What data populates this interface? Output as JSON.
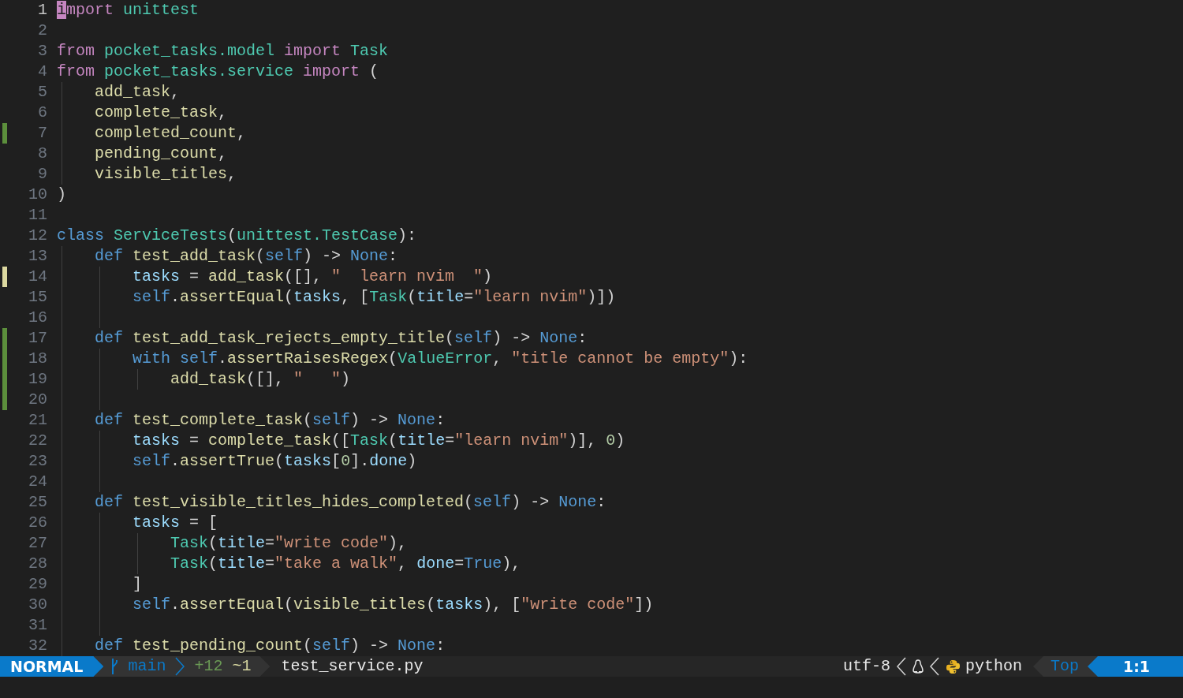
{
  "editor": {
    "lines": [
      {
        "number": "1",
        "cursor": true,
        "tokens": [
          {
            "kind": "keyword",
            "text": "import "
          },
          {
            "kind": "type",
            "text": "unittest"
          }
        ]
      },
      {
        "number": "2"
      },
      {
        "number": "3",
        "tokens": [
          {
            "kind": "keyword",
            "text": "from "
          },
          {
            "kind": "type",
            "text": "pocket_tasks.model "
          },
          {
            "kind": "keyword",
            "text": "import "
          },
          {
            "kind": "type",
            "text": "Task"
          }
        ]
      },
      {
        "number": "4",
        "tokens": [
          {
            "kind": "keyword",
            "text": "from "
          },
          {
            "kind": "type",
            "text": "pocket_tasks.service "
          },
          {
            "kind": "keyword",
            "text": "import "
          },
          {
            "kind": "plain",
            "text": "("
          }
        ]
      },
      {
        "number": "5",
        "tokens": [
          {
            "kind": "func",
            "text": "    add_task"
          },
          {
            "kind": "plain",
            "text": ","
          }
        ]
      },
      {
        "number": "6",
        "tokens": [
          {
            "kind": "func",
            "text": "    complete_task"
          },
          {
            "kind": "plain",
            "text": ","
          }
        ]
      },
      {
        "number": "7",
        "git_added": true,
        "tokens": [
          {
            "kind": "func",
            "text": "    completed_count"
          },
          {
            "kind": "plain",
            "text": ","
          }
        ]
      },
      {
        "number": "8",
        "tokens": [
          {
            "kind": "func",
            "text": "    pending_count"
          },
          {
            "kind": "plain",
            "text": ","
          }
        ]
      },
      {
        "number": "9",
        "tokens": [
          {
            "kind": "func",
            "text": "    visible_titles"
          },
          {
            "kind": "plain",
            "text": ","
          }
        ]
      },
      {
        "number": "10",
        "tokens": [
          {
            "kind": "plain",
            "text": ")"
          }
        ]
      },
      {
        "number": "11"
      },
      {
        "number": "12",
        "tokens": [
          {
            "kind": "storage",
            "text": "class "
          },
          {
            "kind": "type",
            "text": "ServiceTests"
          },
          {
            "kind": "plain",
            "text": "("
          },
          {
            "kind": "type",
            "text": "unittest.TestCase"
          },
          {
            "kind": "plain",
            "text": "):"
          }
        ]
      },
      {
        "number": "13",
        "tokens": [
          {
            "kind": "storage",
            "text": "    def "
          },
          {
            "kind": "func",
            "text": "test_add_task"
          },
          {
            "kind": "plain",
            "text": "("
          },
          {
            "kind": "storage",
            "text": "self"
          },
          {
            "kind": "plain",
            "text": ") -> "
          },
          {
            "kind": "storage",
            "text": "None"
          },
          {
            "kind": "plain",
            "text": ":"
          }
        ]
      },
      {
        "number": "14",
        "git_changed": true,
        "tokens": [
          {
            "kind": "var",
            "text": "        tasks"
          },
          {
            "kind": "plain",
            "text": " = "
          },
          {
            "kind": "func",
            "text": "add_task"
          },
          {
            "kind": "plain",
            "text": "([], "
          },
          {
            "kind": "str",
            "text": "\"  learn nvim  \""
          },
          {
            "kind": "plain",
            "text": ")"
          }
        ]
      },
      {
        "number": "15",
        "tokens": [
          {
            "kind": "storage",
            "text": "        self"
          },
          {
            "kind": "plain",
            "text": "."
          },
          {
            "kind": "func",
            "text": "assertEqual"
          },
          {
            "kind": "plain",
            "text": "("
          },
          {
            "kind": "var",
            "text": "tasks"
          },
          {
            "kind": "plain",
            "text": ", ["
          },
          {
            "kind": "type",
            "text": "Task"
          },
          {
            "kind": "plain",
            "text": "("
          },
          {
            "kind": "var",
            "text": "title"
          },
          {
            "kind": "plain",
            "text": "="
          },
          {
            "kind": "str",
            "text": "\"learn nvim\""
          },
          {
            "kind": "plain",
            "text": ")])"
          }
        ]
      },
      {
        "number": "16"
      },
      {
        "number": "17",
        "git_added": true,
        "tokens": [
          {
            "kind": "storage",
            "text": "    def "
          },
          {
            "kind": "func",
            "text": "test_add_task_rejects_empty_title"
          },
          {
            "kind": "plain",
            "text": "("
          },
          {
            "kind": "storage",
            "text": "self"
          },
          {
            "kind": "plain",
            "text": ") -> "
          },
          {
            "kind": "storage",
            "text": "None"
          },
          {
            "kind": "plain",
            "text": ":"
          }
        ]
      },
      {
        "number": "18",
        "git_added": true,
        "tokens": [
          {
            "kind": "storage",
            "text": "        with self"
          },
          {
            "kind": "plain",
            "text": "."
          },
          {
            "kind": "func",
            "text": "assertRaisesRegex"
          },
          {
            "kind": "plain",
            "text": "("
          },
          {
            "kind": "type",
            "text": "ValueError"
          },
          {
            "kind": "plain",
            "text": ", "
          },
          {
            "kind": "str",
            "text": "\"title cannot be empty\""
          },
          {
            "kind": "plain",
            "text": "):"
          }
        ]
      },
      {
        "number": "19",
        "git_added": true,
        "tokens": [
          {
            "kind": "func",
            "text": "            add_task"
          },
          {
            "kind": "plain",
            "text": "([], "
          },
          {
            "kind": "str",
            "text": "\"   \""
          },
          {
            "kind": "plain",
            "text": ")"
          }
        ]
      },
      {
        "number": "20",
        "git_added": true
      },
      {
        "number": "21",
        "tokens": [
          {
            "kind": "storage",
            "text": "    def "
          },
          {
            "kind": "func",
            "text": "test_complete_task"
          },
          {
            "kind": "plain",
            "text": "("
          },
          {
            "kind": "storage",
            "text": "self"
          },
          {
            "kind": "plain",
            "text": ") -> "
          },
          {
            "kind": "storage",
            "text": "None"
          },
          {
            "kind": "plain",
            "text": ":"
          }
        ]
      },
      {
        "number": "22",
        "tokens": [
          {
            "kind": "var",
            "text": "        tasks"
          },
          {
            "kind": "plain",
            "text": " = "
          },
          {
            "kind": "func",
            "text": "complete_task"
          },
          {
            "kind": "plain",
            "text": "(["
          },
          {
            "kind": "type",
            "text": "Task"
          },
          {
            "kind": "plain",
            "text": "("
          },
          {
            "kind": "var",
            "text": "title"
          },
          {
            "kind": "plain",
            "text": "="
          },
          {
            "kind": "str",
            "text": "\"learn nvim\""
          },
          {
            "kind": "plain",
            "text": ")], "
          },
          {
            "kind": "num",
            "text": "0"
          },
          {
            "kind": "plain",
            "text": ")"
          }
        ]
      },
      {
        "number": "23",
        "tokens": [
          {
            "kind": "storage",
            "text": "        self"
          },
          {
            "kind": "plain",
            "text": "."
          },
          {
            "kind": "func",
            "text": "assertTrue"
          },
          {
            "kind": "plain",
            "text": "("
          },
          {
            "kind": "var",
            "text": "tasks"
          },
          {
            "kind": "plain",
            "text": "["
          },
          {
            "kind": "num",
            "text": "0"
          },
          {
            "kind": "plain",
            "text": "]."
          },
          {
            "kind": "var",
            "text": "done"
          },
          {
            "kind": "plain",
            "text": ")"
          }
        ]
      },
      {
        "number": "24"
      },
      {
        "number": "25",
        "tokens": [
          {
            "kind": "storage",
            "text": "    def "
          },
          {
            "kind": "func",
            "text": "test_visible_titles_hides_completed"
          },
          {
            "kind": "plain",
            "text": "("
          },
          {
            "kind": "storage",
            "text": "self"
          },
          {
            "kind": "plain",
            "text": ") -> "
          },
          {
            "kind": "storage",
            "text": "None"
          },
          {
            "kind": "plain",
            "text": ":"
          }
        ]
      },
      {
        "number": "26",
        "tokens": [
          {
            "kind": "var",
            "text": "        tasks"
          },
          {
            "kind": "plain",
            "text": " = ["
          }
        ]
      },
      {
        "number": "27",
        "tokens": [
          {
            "kind": "type",
            "text": "            Task"
          },
          {
            "kind": "plain",
            "text": "("
          },
          {
            "kind": "var",
            "text": "title"
          },
          {
            "kind": "plain",
            "text": "="
          },
          {
            "kind": "str",
            "text": "\"write code\""
          },
          {
            "kind": "plain",
            "text": "),"
          }
        ]
      },
      {
        "number": "28",
        "tokens": [
          {
            "kind": "type",
            "text": "            Task"
          },
          {
            "kind": "plain",
            "text": "("
          },
          {
            "kind": "var",
            "text": "title"
          },
          {
            "kind": "plain",
            "text": "="
          },
          {
            "kind": "str",
            "text": "\"take a walk\""
          },
          {
            "kind": "plain",
            "text": ", "
          },
          {
            "kind": "var",
            "text": "done"
          },
          {
            "kind": "plain",
            "text": "="
          },
          {
            "kind": "storage",
            "text": "True"
          },
          {
            "kind": "plain",
            "text": "),"
          }
        ]
      },
      {
        "number": "29",
        "tokens": [
          {
            "kind": "plain",
            "text": "        ]"
          }
        ]
      },
      {
        "number": "30",
        "tokens": [
          {
            "kind": "storage",
            "text": "        self"
          },
          {
            "kind": "plain",
            "text": "."
          },
          {
            "kind": "func",
            "text": "assertEqual"
          },
          {
            "kind": "plain",
            "text": "("
          },
          {
            "kind": "func",
            "text": "visible_titles"
          },
          {
            "kind": "plain",
            "text": "("
          },
          {
            "kind": "var",
            "text": "tasks"
          },
          {
            "kind": "plain",
            "text": "), ["
          },
          {
            "kind": "str",
            "text": "\"write code\""
          },
          {
            "kind": "plain",
            "text": "])"
          }
        ]
      },
      {
        "number": "31"
      },
      {
        "number": "32",
        "tokens": [
          {
            "kind": "storage",
            "text": "    def "
          },
          {
            "kind": "func",
            "text": "test_pending_count"
          },
          {
            "kind": "plain",
            "text": "("
          },
          {
            "kind": "storage",
            "text": "self"
          },
          {
            "kind": "plain",
            "text": ") -> "
          },
          {
            "kind": "storage",
            "text": "None"
          },
          {
            "kind": "plain",
            "text": ":"
          }
        ]
      }
    ]
  },
  "status_bar": {
    "mode": "NORMAL",
    "branch": "main",
    "diff_added": "+12",
    "diff_changed": "~1",
    "filename": "test_service.py",
    "encoding": "utf-8",
    "filetype": "python",
    "scroll": "Top",
    "position": "1:1"
  }
}
